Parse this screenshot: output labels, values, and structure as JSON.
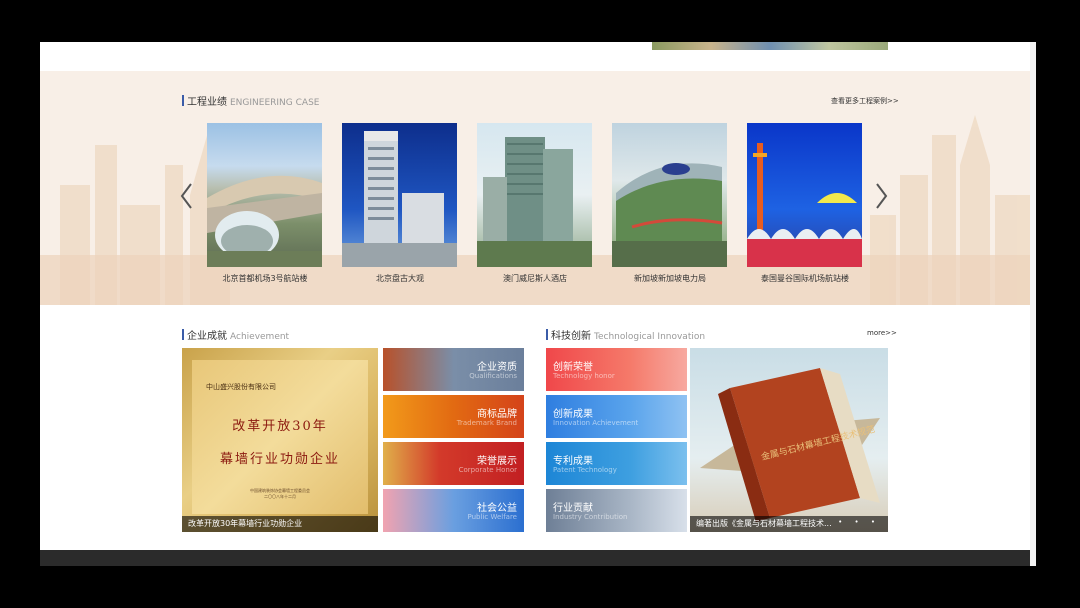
{
  "engineering": {
    "title_cn": "工程业绩",
    "title_en": "ENGINEERING CASE",
    "more": "查看更多工程案例>>",
    "cases": [
      {
        "label": "北京首都机场3号航站楼"
      },
      {
        "label": "北京盘古大观"
      },
      {
        "label": "澳门威尼斯人酒店"
      },
      {
        "label": "新加坡新加坡电力局"
      },
      {
        "label": "泰国曼谷国际机场航站楼"
      }
    ]
  },
  "achievement": {
    "title_cn": "企业成就",
    "title_en": "Achievement",
    "plaque": {
      "company": "中山盛兴股份有限公司",
      "line1": "改革开放30年",
      "line2": "幕墙行业功勋企业",
      "issuer": "中国建筑装饰协会幕墙工程委员会",
      "date": "二〇〇八年十二月"
    },
    "caption": "改革开放30年幕墙行业功勋企业",
    "tiles": [
      {
        "cn": "企业资质",
        "en": "Qualifications"
      },
      {
        "cn": "商标品牌",
        "en": "Trademark Brand"
      },
      {
        "cn": "荣誉展示",
        "en": "Corporate Honor"
      },
      {
        "cn": "社会公益",
        "en": "Public Welfare"
      }
    ]
  },
  "innovation": {
    "title_cn": "科技创新",
    "title_en": "Technological Innovation",
    "more": "more>>",
    "tiles": [
      {
        "cn": "创新荣誉",
        "en": "Technology honor"
      },
      {
        "cn": "创新成果",
        "en": "Innovation Achievement"
      },
      {
        "cn": "专利成果",
        "en": "Patent Technology"
      },
      {
        "cn": "行业贡献",
        "en": "Industry Contribution"
      }
    ],
    "book_caption": "编著出版《金属与石材幕墙工程技术...",
    "book_title": "金属与石材幕墙工程技术规范",
    "dots": "• • •"
  },
  "colors": {
    "accent": "#3b5ca8",
    "section_bg": "#f8efe7",
    "footer": "#2b2b2b"
  }
}
